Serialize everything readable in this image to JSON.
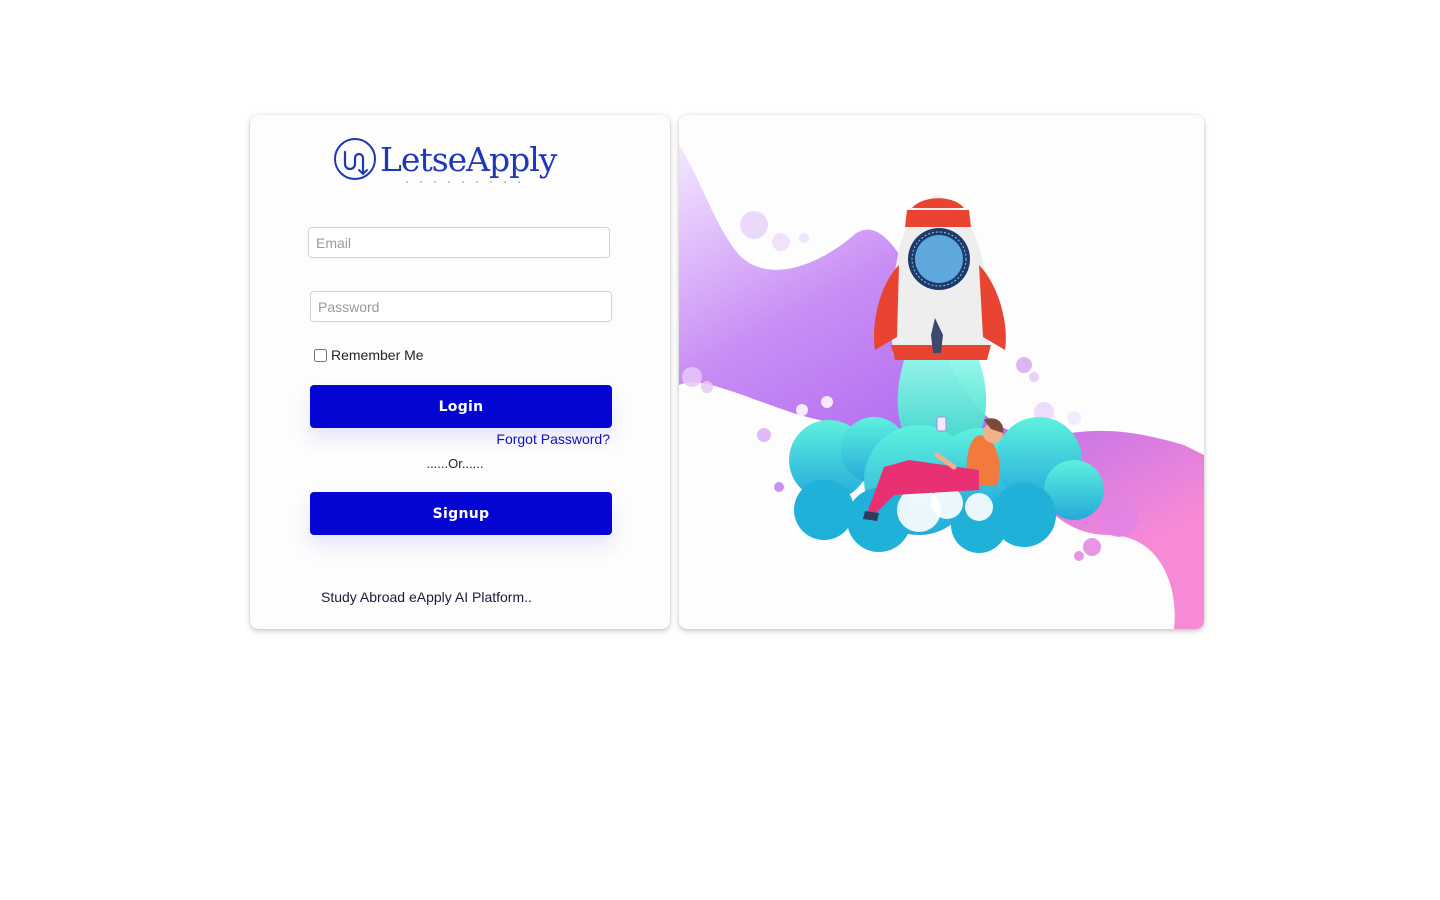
{
  "brand": {
    "logo_text": "LetseApply",
    "primary_color": "#0505d4",
    "logo_color": "#1d38b8"
  },
  "form": {
    "email_placeholder": "Email",
    "password_placeholder": "Password",
    "remember_label": "Remember Me",
    "remember_checked": false,
    "login_label": "Login",
    "forgot_label": "Forgot Password?",
    "or_text": "......Or......",
    "signup_label": "Signup"
  },
  "footer": {
    "tagline": "Study Abroad eApply AI Platform.."
  },
  "illustration": {
    "subject": "rocket-launch-illustration",
    "colors": [
      "#e8d8fb",
      "#b463ee",
      "#f57fd8",
      "#4ee6d9",
      "#e84431"
    ]
  }
}
